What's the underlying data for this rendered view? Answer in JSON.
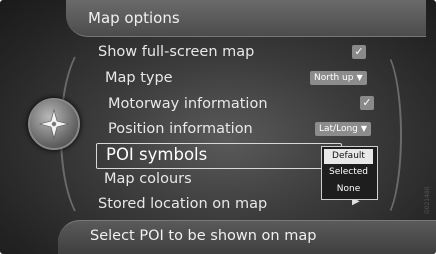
{
  "header": {
    "title": "Map options"
  },
  "menu": {
    "items": [
      {
        "label": "Show full-screen map"
      },
      {
        "label": "Map type",
        "value": "North up"
      },
      {
        "label": "Motorway information"
      },
      {
        "label": "Position information",
        "value": "Lat/Long"
      },
      {
        "label": "POI symbols"
      },
      {
        "label": "Map colours"
      },
      {
        "label": "Stored location on map"
      }
    ]
  },
  "dropdown": {
    "options": [
      "Default",
      "Selected",
      "None"
    ]
  },
  "footer": {
    "status": "Select POI to be shown on map"
  },
  "image_code": "G021480",
  "colors": {
    "background": "#2e2e2e",
    "text": "#e8e8e8",
    "highlight": "#d8d8d8"
  },
  "icons": {
    "knob": "compass-knob-icon",
    "checkbox": "check-icon",
    "arrow": "triangle-right-icon"
  }
}
